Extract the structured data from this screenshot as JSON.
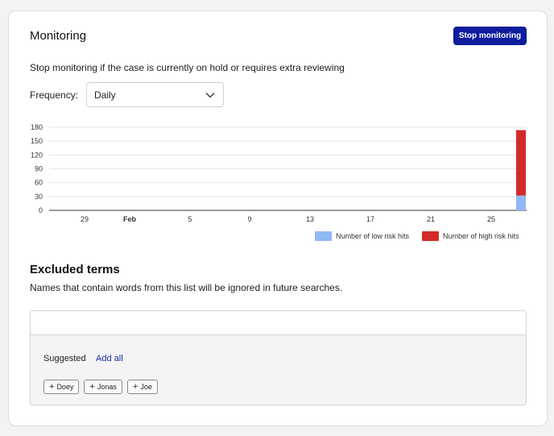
{
  "monitoring": {
    "title": "Monitoring",
    "stop_label": "Stop monitoring",
    "description": "Stop monitoring if the case is currently on hold or requires extra reviewing",
    "frequency_label": "Frequency:",
    "frequency_value": "Daily"
  },
  "chart_data": {
    "type": "bar",
    "stacked": true,
    "y_ticks": [
      "0",
      "30",
      "60",
      "90",
      "120",
      "150",
      "180"
    ],
    "ylim": [
      0,
      180
    ],
    "x_ticks": [
      "29",
      "Feb",
      "5",
      "9",
      "13",
      "17",
      "21",
      "25"
    ],
    "categories": [
      "27 Feb"
    ],
    "series": [
      {
        "name": "Number of low risk hits",
        "color": "#8fb8f5",
        "values": [
          32
        ]
      },
      {
        "name": "Number of high risk hits",
        "color": "#d42a2a",
        "values": [
          142
        ]
      }
    ],
    "legend_position": "bottom-right",
    "grid": true
  },
  "excluded": {
    "title": "Excluded terms",
    "description": "Names that contain words from this list will be ignored in future searches.",
    "input_value": "",
    "suggested_label": "Suggested",
    "add_all_label": "Add all",
    "chips": [
      "Doey",
      "Jonas",
      "Joe"
    ]
  }
}
